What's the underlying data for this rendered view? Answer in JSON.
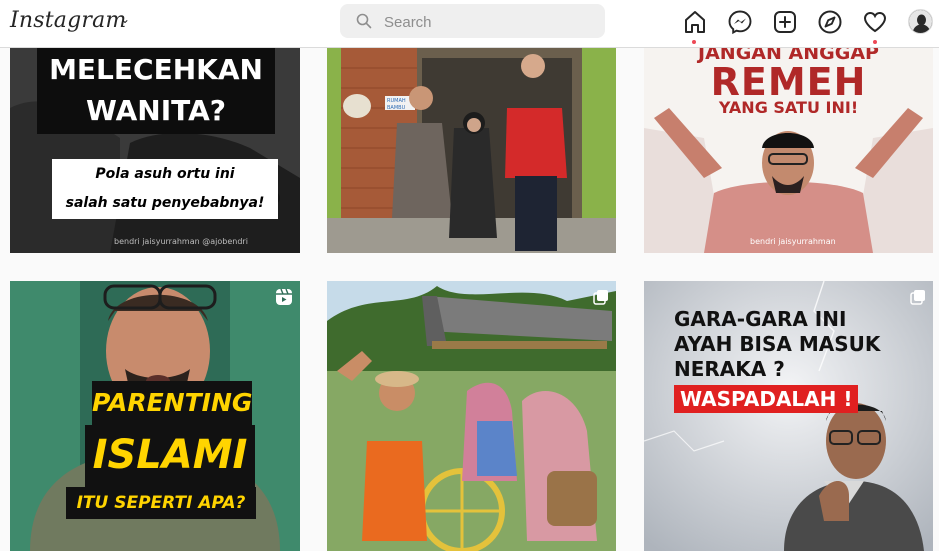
{
  "header": {
    "logo": "Instagram",
    "search": {
      "placeholder": "Search",
      "value": ""
    },
    "nav_icons": [
      "home-icon",
      "messenger-icon",
      "new-post-icon",
      "explore-icon",
      "activity-icon",
      "profile-avatar"
    ],
    "notification_color": "#ed4956"
  },
  "posts": [
    {
      "kind": "image",
      "headline_1": "MELECEHKAN",
      "headline_2": "WANITA?",
      "caption_1": "Pola asuh ortu ini",
      "caption_2": "salah satu penyebabnya!",
      "credit": "bendri jaisyurrahman @ajobendri"
    },
    {
      "kind": "photo",
      "sign_1": "RUMAH",
      "sign_2": "BAMBU"
    },
    {
      "kind": "image",
      "headline_1": "JANGAN ANGGAP",
      "headline_2": "REMEH",
      "headline_3": "YANG SATU INI!",
      "credit": "bendri jaisyurrahman"
    },
    {
      "kind": "reel",
      "headline_1": "PARENTING",
      "headline_2": "ISLAMI",
      "headline_3": "ITU SEPERTI APA?"
    },
    {
      "kind": "carousel",
      "headline_1": "",
      "headline_2": ""
    },
    {
      "kind": "carousel",
      "headline_1": "GARA-GARA INI",
      "headline_2": "AYAH BISA MASUK",
      "headline_3": "NERAKA ?",
      "headline_4": "WASPADALAH !"
    }
  ],
  "colors": {
    "accent_red": "#e02020",
    "headline_yellow": "#ffd400",
    "text_dark": "#262626"
  }
}
